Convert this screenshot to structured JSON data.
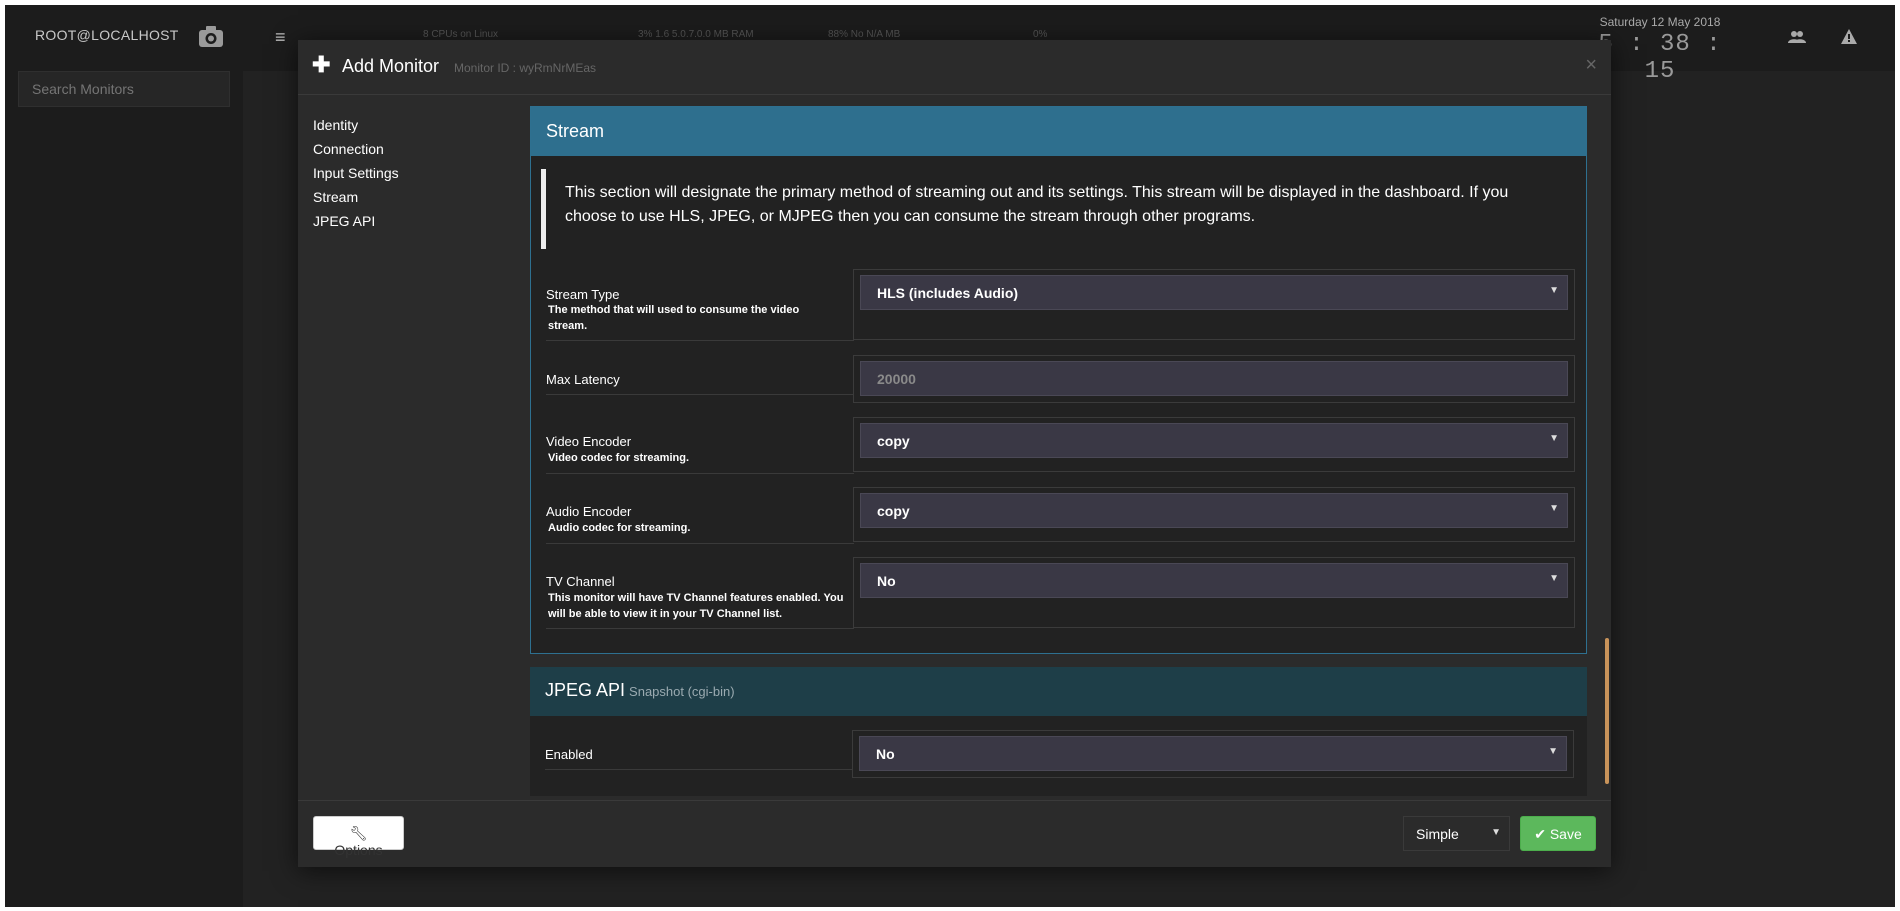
{
  "app": {
    "brand": "ROOT@LOCALHOST",
    "search_placeholder": "Search Monitors",
    "top_info_1": "8 CPUs on Linux",
    "top_info_2": "3% 1.6 5.0.7.0.0 MB RAM",
    "top_info_3": "88% No N/A MB",
    "top_info_4": "0%",
    "date": "Saturday 12 May 2018",
    "clock": "5 : 38 : 15"
  },
  "modal": {
    "title": "Add Monitor",
    "monitor_id": "Monitor ID : wyRmNrMEas",
    "close": "×",
    "nav": [
      "Identity",
      "Connection",
      "Input Settings",
      "Stream",
      "JPEG API"
    ]
  },
  "stream": {
    "heading": "Stream",
    "callout": "This section will designate the primary method of streaming out and its settings. This stream will be displayed in the dashboard. If you choose to use HLS, JPEG, or MJPEG then you can consume the stream through other programs.",
    "stream_type": {
      "label": "Stream Type",
      "desc": "The method that will used to consume the video stream.",
      "value": "HLS (includes Audio)"
    },
    "max_latency": {
      "label": "Max Latency",
      "placeholder": "20000"
    },
    "video_encoder": {
      "label": "Video Encoder",
      "desc": "Video codec for streaming.",
      "value": "copy"
    },
    "audio_encoder": {
      "label": "Audio Encoder",
      "desc": "Audio codec for streaming.",
      "value": "copy"
    },
    "tv_channel": {
      "label": "TV Channel",
      "desc": "This monitor will have TV Channel features enabled. You will be able to view it in your TV Channel list.",
      "value": "No"
    }
  },
  "jpeg_api": {
    "heading": "JPEG API",
    "subheading": "Snapshot (cgi-bin)",
    "enabled": {
      "label": "Enabled",
      "value": "No"
    }
  },
  "footer": {
    "options_label": "Options",
    "mode_value": "Simple",
    "save_label": "Save"
  },
  "colors": {
    "stream_header": "#2e6f8e",
    "jpeg_header": "#1e3e48",
    "save_button": "#5cb85c",
    "scroll_thumb": "#c8935a"
  },
  "icons": [
    "camera-icon",
    "menu-icon",
    "plus-icon",
    "users-icon",
    "warning-icon",
    "wrench-icon",
    "check-icon",
    "caret-down-icon"
  ]
}
